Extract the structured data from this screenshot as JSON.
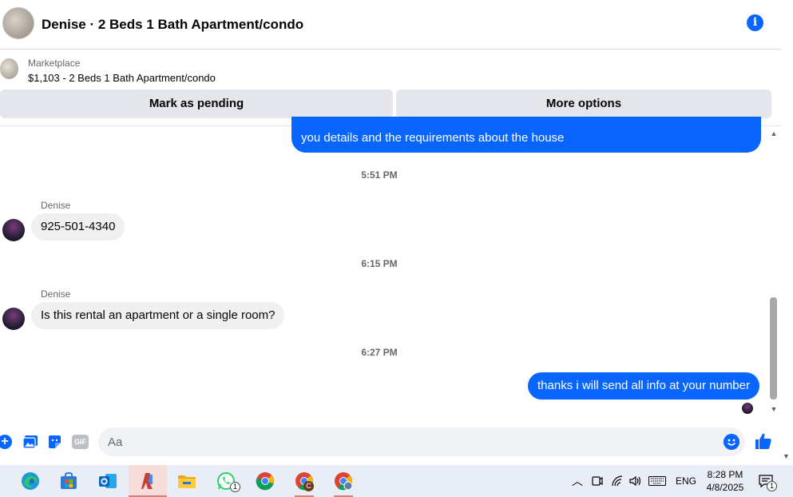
{
  "header": {
    "title": "Denise · 2 Beds 1 Bath Apartment/condo",
    "info_icon": "i"
  },
  "marketplace": {
    "label": "Marketplace",
    "listing": "$1,103 - 2 Beds 1 Bath Apartment/condo"
  },
  "actions": {
    "pending": "Mark as pending",
    "more": "More options"
  },
  "messages": {
    "out_1": "you details and the requirements about the house",
    "time_1": "5:51 PM",
    "sender_1": "Denise",
    "in_1": "925-501-4340",
    "time_2": "6:15 PM",
    "sender_2": "Denise",
    "in_2": "Is this rental an apartment or a single room?",
    "time_3": "6:27 PM",
    "out_2": "thanks i will send all info at your number"
  },
  "composer": {
    "placeholder": "Aa",
    "gif_label": "GIF"
  },
  "taskbar": {
    "whatsapp_badge": "1",
    "chrome_profile_letter": "C",
    "language": "ENG",
    "time": "8:28 PM",
    "date": "4/8/2025",
    "notifications_badge": "1"
  },
  "colors": {
    "accent": "#0866ff",
    "bubble_in": "#f0f0f0",
    "button_bg": "#e4e6eb",
    "taskbar_bg": "#e9eef6"
  },
  "icons": [
    "info-icon",
    "plus-icon",
    "gallery-icon",
    "sticker-icon",
    "gif-icon",
    "emoji-icon",
    "like-icon",
    "edge-icon",
    "store-icon",
    "outlook-icon",
    "app-icon",
    "file-explorer-icon",
    "whatsapp-icon",
    "chrome-icon",
    "chrome-profile-icon",
    "chrome-active-icon",
    "chevron-up-icon",
    "meet-icon",
    "wifi-icon",
    "volume-icon",
    "keyboard-icon",
    "notifications-icon"
  ]
}
